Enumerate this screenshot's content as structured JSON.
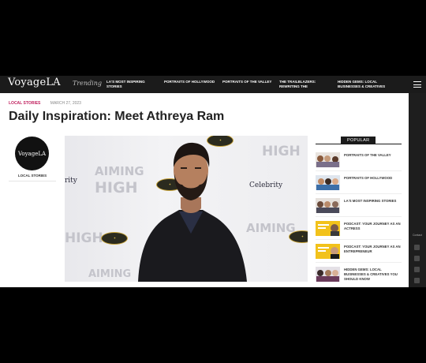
{
  "nav": {
    "logo": "VoyageLA",
    "trending": "Trending",
    "links": [
      "LA's Most Inspiring Stories",
      "Portraits of Hollywood",
      "Portraits of the Valley",
      "The Trailblazers: Rewriting the",
      "Hidden Gems: Local Businesses & Creatives"
    ]
  },
  "article": {
    "category": "LOCAL STORIES",
    "date": "MARCH 27, 2023",
    "title": "Daily Inspiration: Meet Athreya Ram"
  },
  "author": {
    "logo": "VoyageLA",
    "label": "LOCAL STORIES"
  },
  "hero": {
    "wall_words": [
      "AIMING",
      "HIGH",
      "Celebrity",
      "rity"
    ]
  },
  "popular": {
    "heading": "POPULAR",
    "items": [
      "Portraits of the Valley",
      "Portraits of Hollywood",
      "LA's Most Inspiring Stories",
      "Podcast: Your Journey as an Actress",
      "Podcast: Your Journey as an Entrepreneur",
      "Hidden Gems: Local Businesses & Creatives You Should Know"
    ]
  },
  "rail": {
    "contact": "Contact"
  },
  "colors": {
    "accent": "#c01f5d",
    "nav_bg": "#1b1b1b",
    "podcast_yellow": "#f2c21b"
  }
}
